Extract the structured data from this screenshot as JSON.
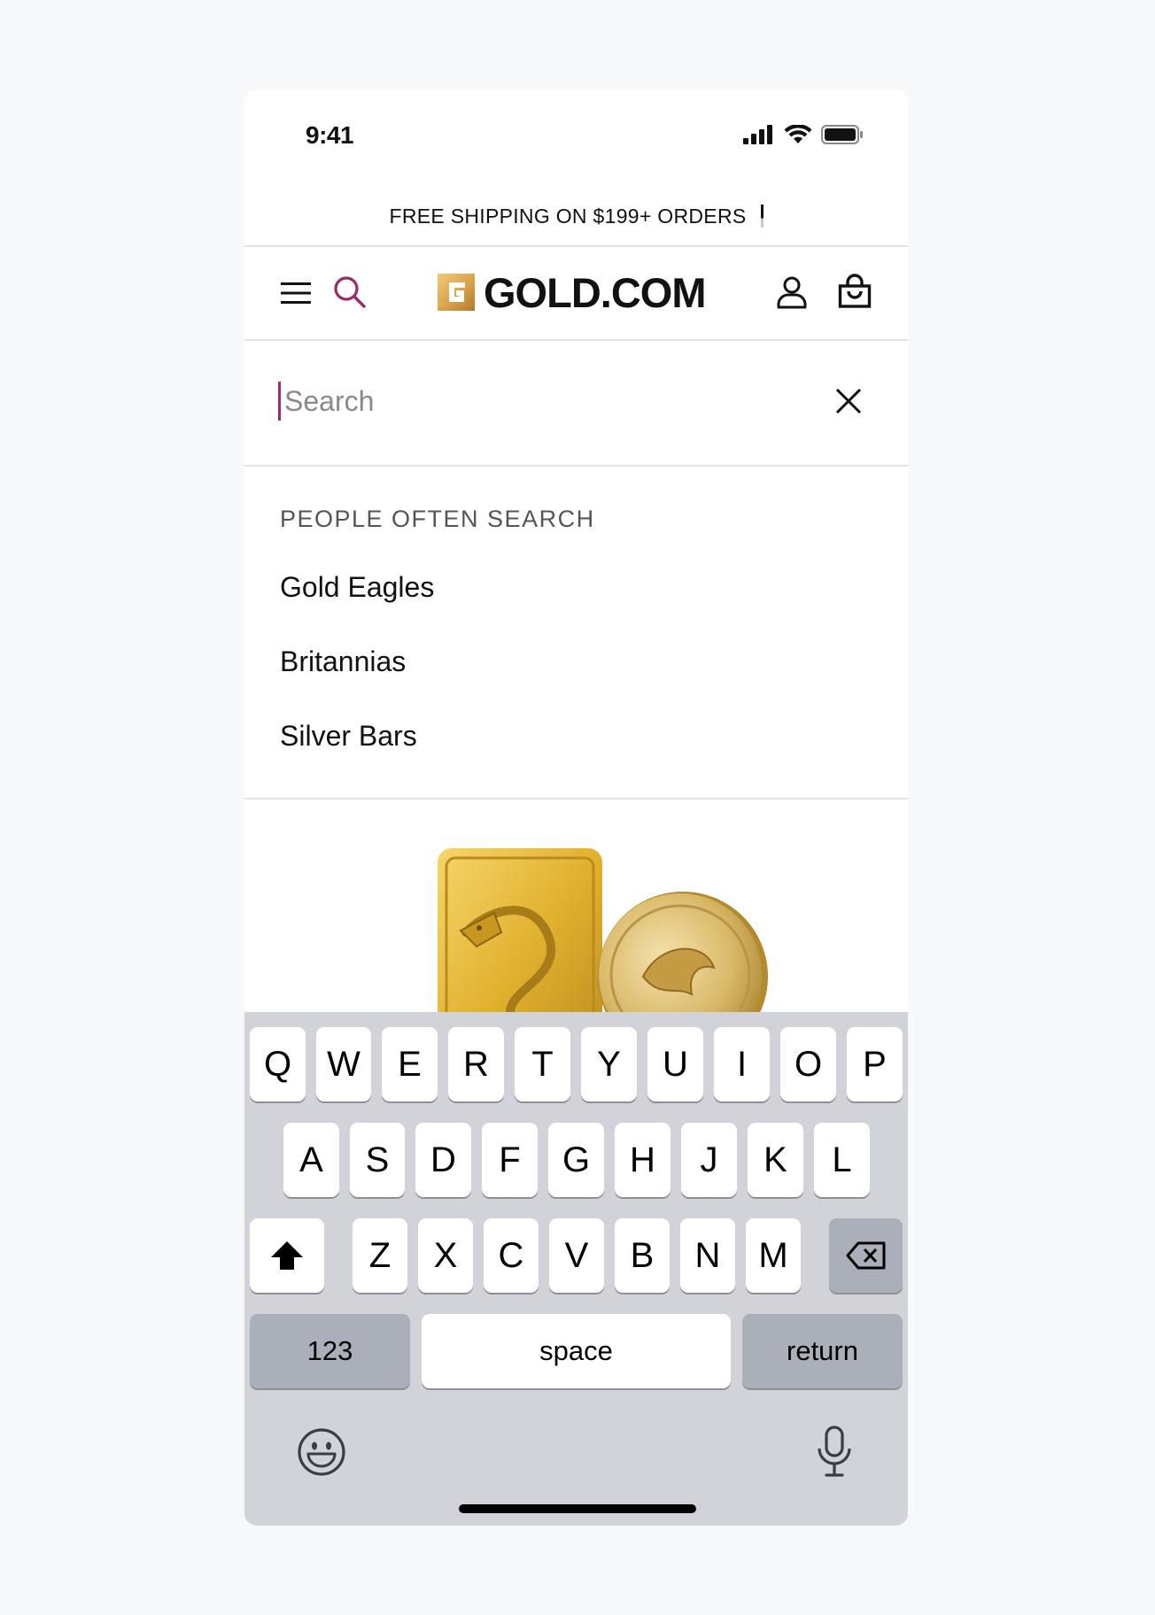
{
  "status_bar": {
    "time": "9:41"
  },
  "promo_banner": {
    "text": "FREE SHIPPING ON $199+ ORDERS"
  },
  "header": {
    "logo_text": "GOLD.COM",
    "icons": [
      "menu-icon",
      "search-icon",
      "account-icon",
      "cart-icon"
    ]
  },
  "search": {
    "placeholder": "Search",
    "value": ""
  },
  "suggestions": {
    "heading": "PEOPLE OFTEN SEARCH",
    "items": [
      "Gold Eagles",
      "Britannias",
      "Silver Bars"
    ]
  },
  "keyboard": {
    "row1": [
      "Q",
      "W",
      "E",
      "R",
      "T",
      "Y",
      "U",
      "I",
      "O",
      "P"
    ],
    "row2": [
      "A",
      "S",
      "D",
      "F",
      "G",
      "H",
      "J",
      "K",
      "L"
    ],
    "row3": [
      "Z",
      "X",
      "C",
      "V",
      "B",
      "N",
      "M"
    ],
    "numbers_label": "123",
    "space_label": "space",
    "return_label": "return"
  },
  "colors": {
    "accent": "#9b2a66",
    "logo_gold": "#d9a24a",
    "keyboard_bg": "#d1d3d9"
  }
}
